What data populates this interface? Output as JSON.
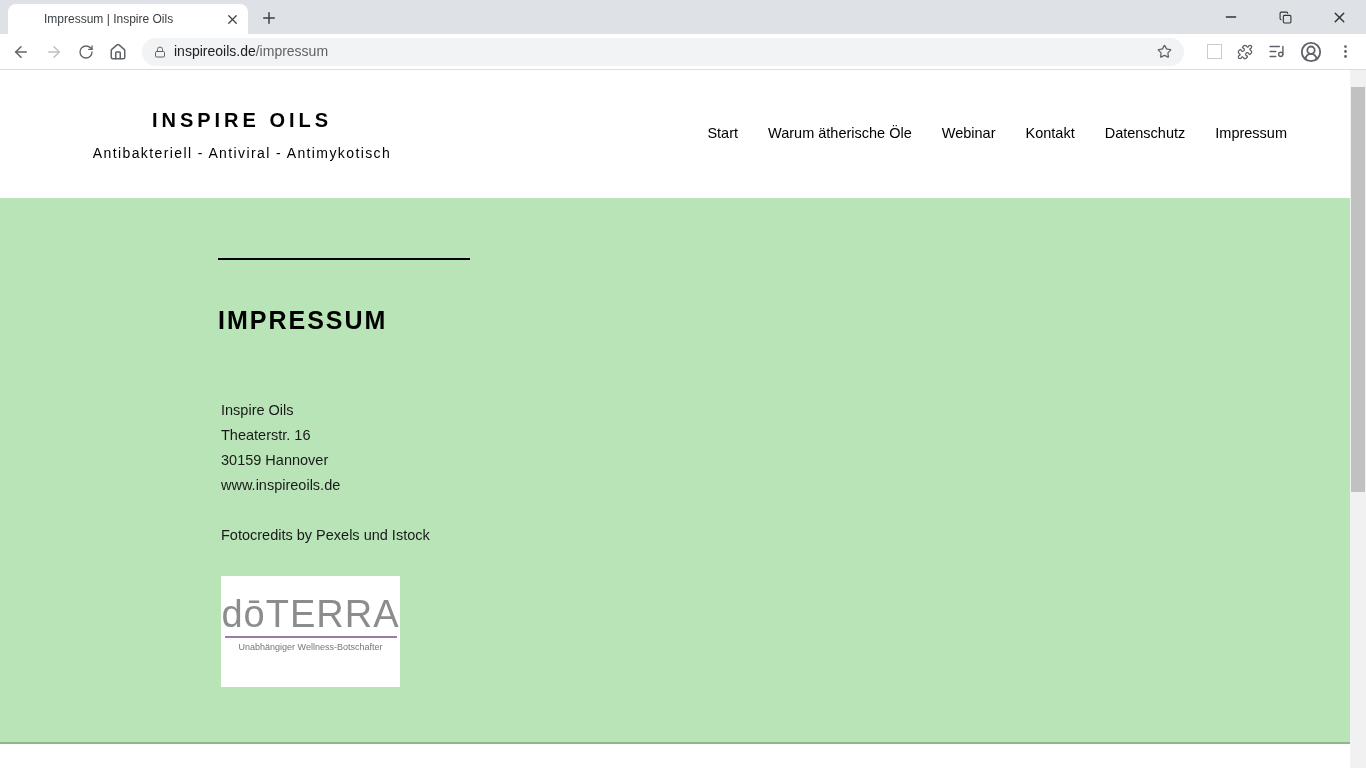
{
  "browser": {
    "tab_title": "Impressum | Inspire Oils",
    "url_host": "inspireoils.de",
    "url_path": "/impressum"
  },
  "site": {
    "title": "INSPIRE OILS",
    "tagline": "Antibakteriell - Antiviral - Antimykotisch"
  },
  "nav": [
    {
      "label": "Start"
    },
    {
      "label": "Warum ätherische Öle"
    },
    {
      "label": "Webinar"
    },
    {
      "label": "Kontakt"
    },
    {
      "label": "Datenschutz"
    },
    {
      "label": "Impressum"
    }
  ],
  "content": {
    "heading": "IMPRESSUM",
    "address_lines": [
      "Inspire Oils",
      "Theaterstr. 16",
      "30159 Hannover",
      "www.inspireoils.de"
    ],
    "credits": "Fotocredits by Pexels und Istock"
  },
  "logo": {
    "brand": "dōTERRA",
    "caption": "Unabhängiger Wellness-Botschafter"
  }
}
